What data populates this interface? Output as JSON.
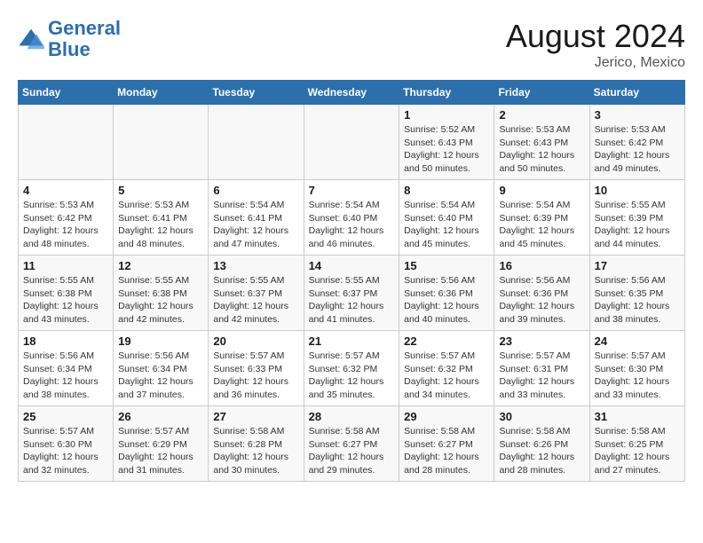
{
  "header": {
    "logo_line1": "General",
    "logo_line2": "Blue",
    "month_year": "August 2024",
    "location": "Jerico, Mexico"
  },
  "weekdays": [
    "Sunday",
    "Monday",
    "Tuesday",
    "Wednesday",
    "Thursday",
    "Friday",
    "Saturday"
  ],
  "weeks": [
    [
      {
        "day": "",
        "info": ""
      },
      {
        "day": "",
        "info": ""
      },
      {
        "day": "",
        "info": ""
      },
      {
        "day": "",
        "info": ""
      },
      {
        "day": "1",
        "info": "Sunrise: 5:52 AM\nSunset: 6:43 PM\nDaylight: 12 hours\nand 50 minutes."
      },
      {
        "day": "2",
        "info": "Sunrise: 5:53 AM\nSunset: 6:43 PM\nDaylight: 12 hours\nand 50 minutes."
      },
      {
        "day": "3",
        "info": "Sunrise: 5:53 AM\nSunset: 6:42 PM\nDaylight: 12 hours\nand 49 minutes."
      }
    ],
    [
      {
        "day": "4",
        "info": "Sunrise: 5:53 AM\nSunset: 6:42 PM\nDaylight: 12 hours\nand 48 minutes."
      },
      {
        "day": "5",
        "info": "Sunrise: 5:53 AM\nSunset: 6:41 PM\nDaylight: 12 hours\nand 48 minutes."
      },
      {
        "day": "6",
        "info": "Sunrise: 5:54 AM\nSunset: 6:41 PM\nDaylight: 12 hours\nand 47 minutes."
      },
      {
        "day": "7",
        "info": "Sunrise: 5:54 AM\nSunset: 6:40 PM\nDaylight: 12 hours\nand 46 minutes."
      },
      {
        "day": "8",
        "info": "Sunrise: 5:54 AM\nSunset: 6:40 PM\nDaylight: 12 hours\nand 45 minutes."
      },
      {
        "day": "9",
        "info": "Sunrise: 5:54 AM\nSunset: 6:39 PM\nDaylight: 12 hours\nand 45 minutes."
      },
      {
        "day": "10",
        "info": "Sunrise: 5:55 AM\nSunset: 6:39 PM\nDaylight: 12 hours\nand 44 minutes."
      }
    ],
    [
      {
        "day": "11",
        "info": "Sunrise: 5:55 AM\nSunset: 6:38 PM\nDaylight: 12 hours\nand 43 minutes."
      },
      {
        "day": "12",
        "info": "Sunrise: 5:55 AM\nSunset: 6:38 PM\nDaylight: 12 hours\nand 42 minutes."
      },
      {
        "day": "13",
        "info": "Sunrise: 5:55 AM\nSunset: 6:37 PM\nDaylight: 12 hours\nand 42 minutes."
      },
      {
        "day": "14",
        "info": "Sunrise: 5:55 AM\nSunset: 6:37 PM\nDaylight: 12 hours\nand 41 minutes."
      },
      {
        "day": "15",
        "info": "Sunrise: 5:56 AM\nSunset: 6:36 PM\nDaylight: 12 hours\nand 40 minutes."
      },
      {
        "day": "16",
        "info": "Sunrise: 5:56 AM\nSunset: 6:36 PM\nDaylight: 12 hours\nand 39 minutes."
      },
      {
        "day": "17",
        "info": "Sunrise: 5:56 AM\nSunset: 6:35 PM\nDaylight: 12 hours\nand 38 minutes."
      }
    ],
    [
      {
        "day": "18",
        "info": "Sunrise: 5:56 AM\nSunset: 6:34 PM\nDaylight: 12 hours\nand 38 minutes."
      },
      {
        "day": "19",
        "info": "Sunrise: 5:56 AM\nSunset: 6:34 PM\nDaylight: 12 hours\nand 37 minutes."
      },
      {
        "day": "20",
        "info": "Sunrise: 5:57 AM\nSunset: 6:33 PM\nDaylight: 12 hours\nand 36 minutes."
      },
      {
        "day": "21",
        "info": "Sunrise: 5:57 AM\nSunset: 6:32 PM\nDaylight: 12 hours\nand 35 minutes."
      },
      {
        "day": "22",
        "info": "Sunrise: 5:57 AM\nSunset: 6:32 PM\nDaylight: 12 hours\nand 34 minutes."
      },
      {
        "day": "23",
        "info": "Sunrise: 5:57 AM\nSunset: 6:31 PM\nDaylight: 12 hours\nand 33 minutes."
      },
      {
        "day": "24",
        "info": "Sunrise: 5:57 AM\nSunset: 6:30 PM\nDaylight: 12 hours\nand 33 minutes."
      }
    ],
    [
      {
        "day": "25",
        "info": "Sunrise: 5:57 AM\nSunset: 6:30 PM\nDaylight: 12 hours\nand 32 minutes."
      },
      {
        "day": "26",
        "info": "Sunrise: 5:57 AM\nSunset: 6:29 PM\nDaylight: 12 hours\nand 31 minutes."
      },
      {
        "day": "27",
        "info": "Sunrise: 5:58 AM\nSunset: 6:28 PM\nDaylight: 12 hours\nand 30 minutes."
      },
      {
        "day": "28",
        "info": "Sunrise: 5:58 AM\nSunset: 6:27 PM\nDaylight: 12 hours\nand 29 minutes."
      },
      {
        "day": "29",
        "info": "Sunrise: 5:58 AM\nSunset: 6:27 PM\nDaylight: 12 hours\nand 28 minutes."
      },
      {
        "day": "30",
        "info": "Sunrise: 5:58 AM\nSunset: 6:26 PM\nDaylight: 12 hours\nand 28 minutes."
      },
      {
        "day": "31",
        "info": "Sunrise: 5:58 AM\nSunset: 6:25 PM\nDaylight: 12 hours\nand 27 minutes."
      }
    ]
  ]
}
